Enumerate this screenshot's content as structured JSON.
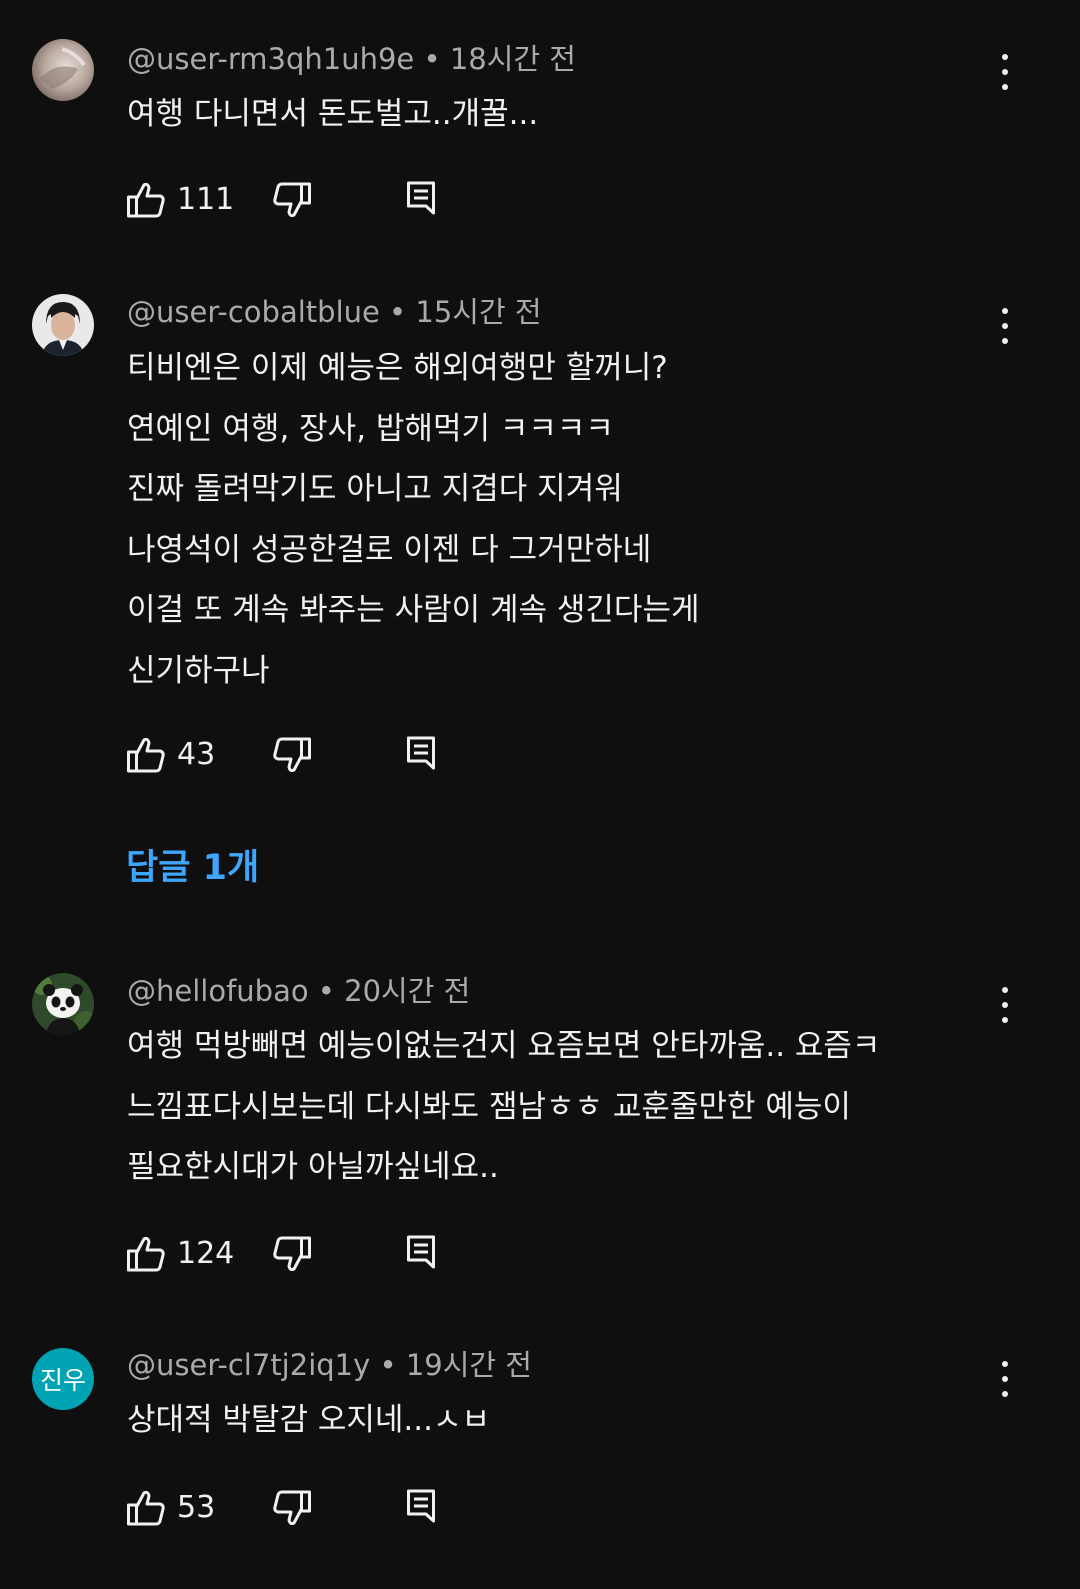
{
  "comments": [
    {
      "handle": "@user-rm3qh1uh9e",
      "time": "18시간 전",
      "lines": [
        "여행 다니면서 돈도벌고..개꿀..."
      ],
      "likes": "111",
      "avatar": "photo"
    },
    {
      "handle": "@user-cobaltblue",
      "time": "15시간 전",
      "lines": [
        "티비엔은 이제 예능은 해외여행만 할꺼니?",
        "연예인 여행, 장사, 밥해먹기 ㅋㅋㅋㅋ",
        "진짜 돌려막기도 아니고 지겹다 지겨워",
        "나영석이 성공한걸로 이젠 다 그거만하네",
        "이걸 또 계속 봐주는 사람이 계속 생긴다는게",
        "신기하구나"
      ],
      "likes": "43",
      "avatar": "photo",
      "replies_label": "답글 1개"
    },
    {
      "handle": "@hellofubao",
      "time": "20시간 전",
      "lines": [
        "여행 먹방빼면 예능이없는건지 요즘보면 안타까움.. 요즘ㅋ",
        "느낌표다시보는데 다시봐도 잼남ㅎㅎ 교훈줄만한 예능이",
        "필요한시대가 아닐까싶네요.."
      ],
      "likes": "124",
      "avatar": "panda-photo"
    },
    {
      "handle": "@user-cl7tj2iq1y",
      "time": "19시간 전",
      "lines": [
        "상대적 박탈감 오지네...ㅅㅂ"
      ],
      "likes": "53",
      "avatar_text": "진우",
      "avatar_color": "#00a3b4"
    }
  ],
  "separator": " • ",
  "icons": {
    "like": "thumb-up-icon",
    "dislike": "thumb-down-icon",
    "reply": "comment-reply-icon",
    "menu": "more-vert-icon"
  },
  "colors": {
    "background": "#0f0f0f",
    "text": "#f1f1f1",
    "meta": "#aaaaaa",
    "link": "#3ea6ff"
  }
}
